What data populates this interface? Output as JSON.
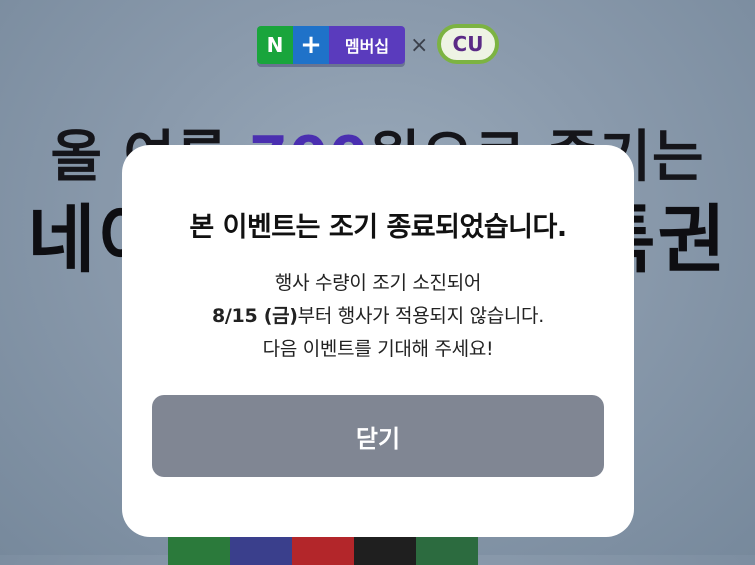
{
  "logos": {
    "npay_n": "N",
    "npay_plus": "+",
    "npay_member": "멤버십",
    "cross": "×",
    "cu": "CU"
  },
  "background": {
    "headline_part1": "올 여름 ",
    "headline_highlight": "700",
    "headline_part2": "원으로 즐기는",
    "headline_line2_left": "네이",
    "headline_line2_right": "특권"
  },
  "modal": {
    "title": "본 이벤트는 조기 종료되었습니다.",
    "line1": "행사 수량이 조기 소진되어",
    "line2_bold": "8/15 (금)",
    "line2_rest": "부터 행사가 적용되지 않습니다.",
    "line3": "다음 이벤트를 기대해 주세요!",
    "close_label": "닫기"
  },
  "colors": {
    "accent_purple": "#4a2fb0",
    "button_gray": "#808693",
    "naver_green": "#19a53c",
    "cu_green": "#7cb342"
  }
}
